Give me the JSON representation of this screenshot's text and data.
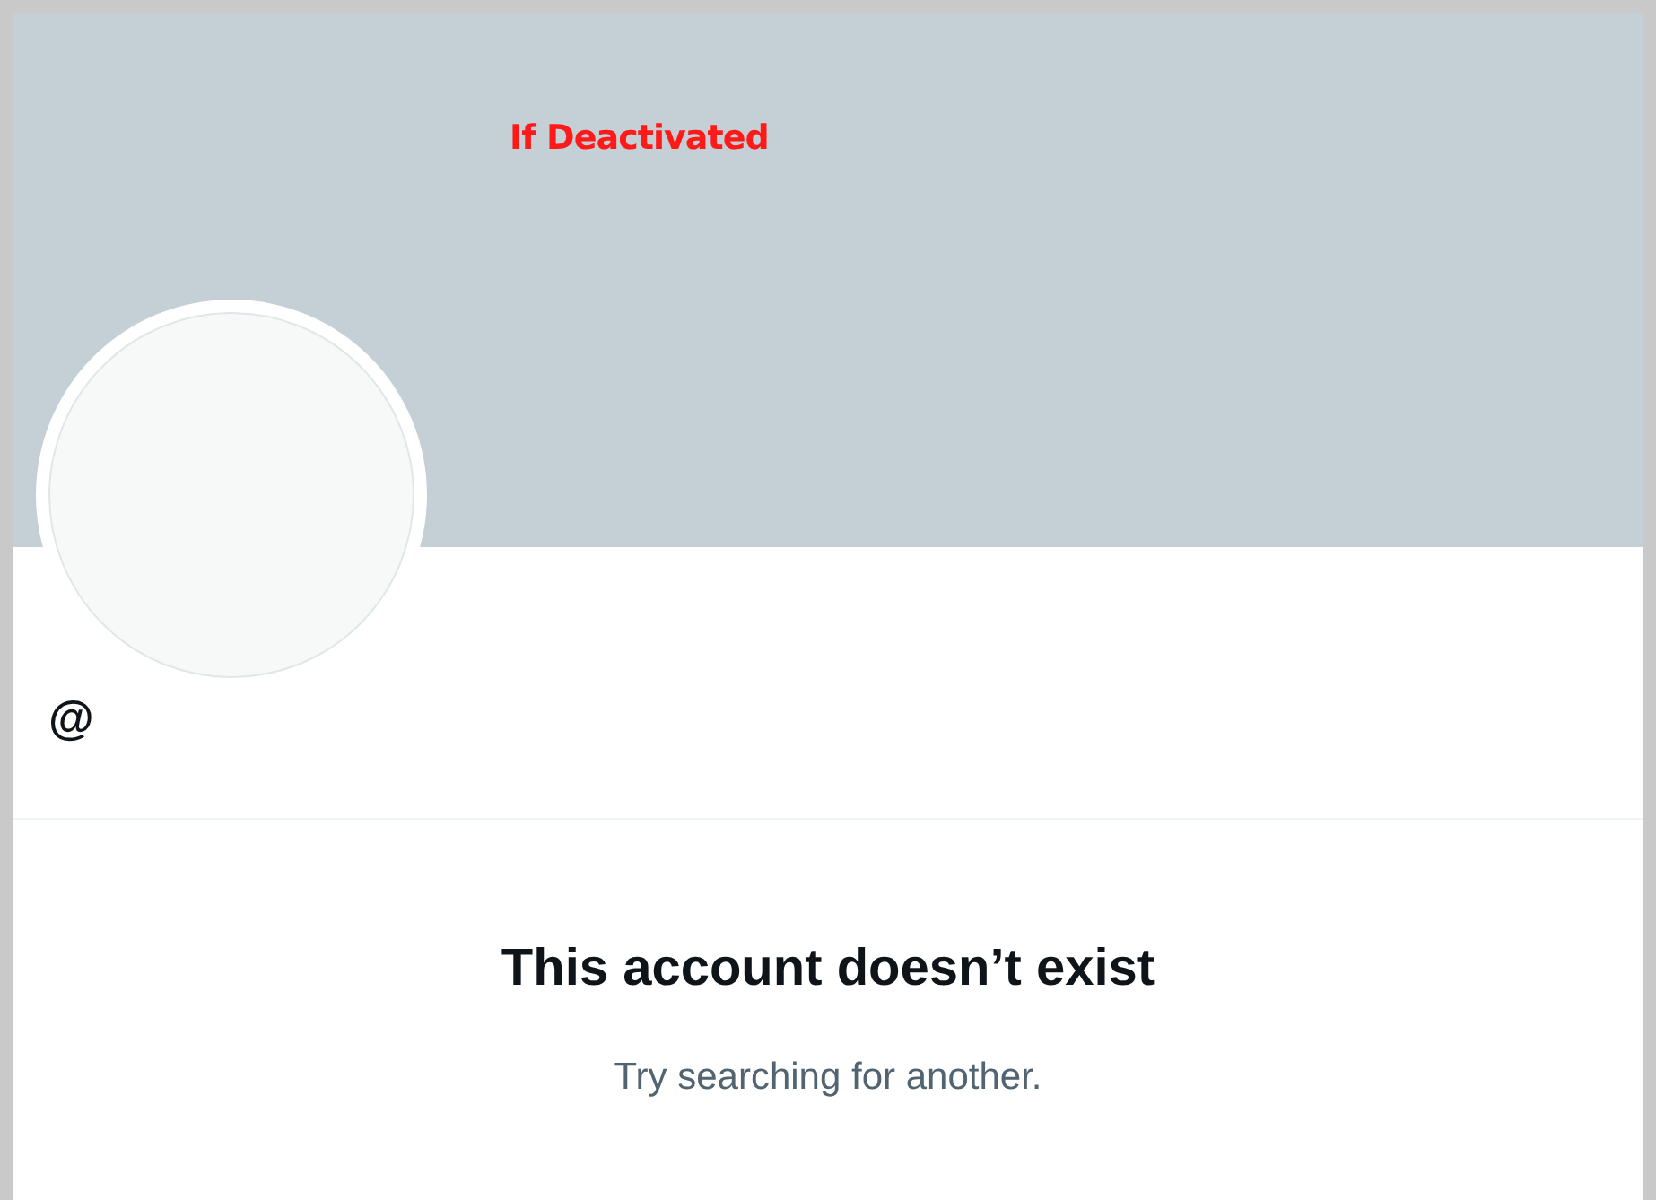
{
  "annotation": "If Deactivated",
  "profile": {
    "avatar": {
      "kind": "empty"
    },
    "handle": "@"
  },
  "empty_state": {
    "title": "This account doesn’t exist",
    "subtitle": "Try searching for another."
  }
}
